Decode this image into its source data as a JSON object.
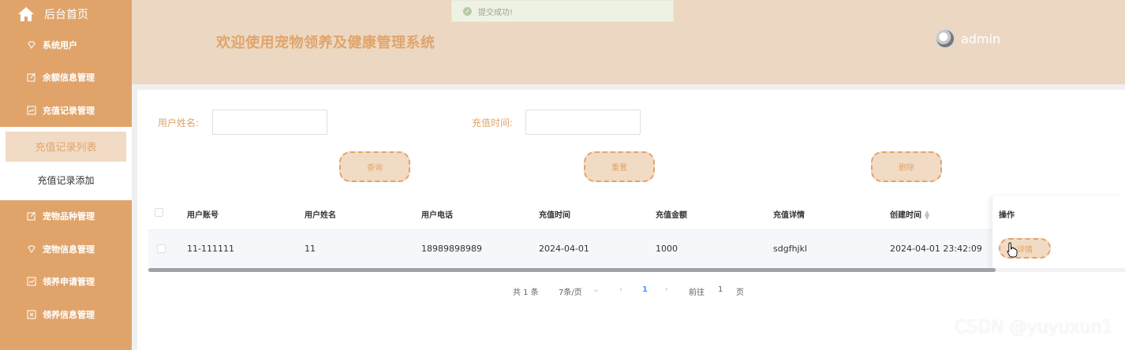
{
  "sidebar": {
    "home_label": "后台首页",
    "items_top": [
      {
        "label": "系统用户",
        "icon": "gem-icon"
      },
      {
        "label": "余额信息管理",
        "icon": "edit-icon"
      },
      {
        "label": "充值记录管理",
        "icon": "chart-icon"
      }
    ],
    "submenu": [
      {
        "label": "充值记录列表",
        "active": true
      },
      {
        "label": "充值记录添加",
        "active": false
      }
    ],
    "items_bottom": [
      {
        "label": "宠物品种管理",
        "icon": "edit-icon"
      },
      {
        "label": "宠物信息管理",
        "icon": "gem-icon"
      },
      {
        "label": "领养申请管理",
        "icon": "chart-icon"
      },
      {
        "label": "领养信息管理",
        "icon": "close-box-icon"
      }
    ]
  },
  "header": {
    "title": "欢迎使用宠物领养及健康管理系统",
    "username": "admin"
  },
  "toast": {
    "message": "提交成功!"
  },
  "search": {
    "name_label": "用户姓名:",
    "name_value": "",
    "time_label": "充值时间:",
    "time_value": "",
    "query_button": "查询",
    "reset_button": "重置",
    "delete_button": "删除"
  },
  "table": {
    "columns": [
      "用户账号",
      "用户姓名",
      "用户电话",
      "充值时间",
      "充值金额",
      "充值详情",
      "创建时间",
      "操作"
    ],
    "rows": [
      {
        "account": "11-111111",
        "name": "11",
        "phone": "18989898989",
        "recharge_time": "2024-04-01",
        "amount": "1000",
        "detail": "sdgfhjkl",
        "created": "2024-04-01 23:42:09",
        "action": "详情"
      }
    ]
  },
  "pagination": {
    "total": "共 1 条",
    "page_size": "7条/页",
    "current_page": "1",
    "goto_prefix": "前往",
    "goto_value": "1",
    "goto_suffix": "页"
  },
  "watermark": "CSDN @yuyuxun1",
  "colors": {
    "accent": "#e0a46b",
    "accent_light": "#f2dbc4",
    "header_bg": "#ecd8c2",
    "link": "#409eff"
  }
}
